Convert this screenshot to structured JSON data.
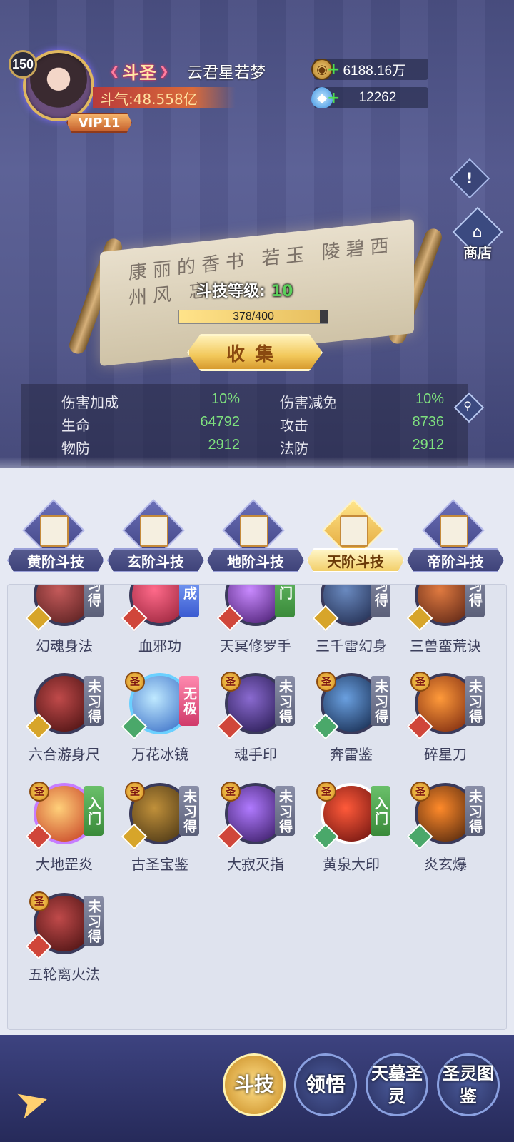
{
  "header": {
    "level": "150",
    "rank_title": "斗圣",
    "player_name": "云君星若梦",
    "power_label": "斗气:48.558亿",
    "vip": "VIP11",
    "gold": "6188.16万",
    "gems": "12262"
  },
  "side": {
    "notice_icon": "!",
    "shop_label": "商店"
  },
  "scroll": {
    "calligraphy": "康丽的香书 若玉 陵碧西 州风 忘",
    "level_label": "斗技等级:",
    "level_value": "10",
    "progress_text": "378/400",
    "progress_fraction": 0.945,
    "collect_label": "收集"
  },
  "stats": {
    "dmg_bonus_label": "伤害加成",
    "dmg_bonus_value": "10%",
    "dmg_reduce_label": "伤害减免",
    "dmg_reduce_value": "10%",
    "hp_label": "生命",
    "hp_value": "64792",
    "atk_label": "攻击",
    "atk_value": "8736",
    "pdef_label": "物防",
    "pdef_value": "2912",
    "mdef_label": "法防",
    "mdef_value": "2912"
  },
  "tabs": [
    {
      "label": "黄阶斗技",
      "active": false
    },
    {
      "label": "玄阶斗技",
      "active": false
    },
    {
      "label": "地阶斗技",
      "active": false
    },
    {
      "label": "天阶斗技",
      "active": true
    },
    {
      "label": "帝阶斗技",
      "active": false
    }
  ],
  "skills": [
    {
      "name": "幻魂身法",
      "status": "习得",
      "badge": "",
      "element": "gold"
    },
    {
      "name": "血邪功",
      "status": "成",
      "badge": "",
      "element": "fire"
    },
    {
      "name": "天冥修罗手",
      "status": "门",
      "badge": "",
      "element": "fire"
    },
    {
      "name": "三千雷幻身",
      "status": "习得",
      "badge": "",
      "element": "gold"
    },
    {
      "name": "三兽蛮荒诀",
      "status": "习得",
      "badge": "",
      "element": "gold"
    },
    {
      "name": "六合游身尺",
      "status": "未习得",
      "badge": "",
      "element": "gold"
    },
    {
      "name": "万花冰镜",
      "status": "无极",
      "badge": "圣",
      "element": "wood"
    },
    {
      "name": "魂手印",
      "status": "未习得",
      "badge": "圣",
      "element": "fire"
    },
    {
      "name": "奔雷鉴",
      "status": "未习得",
      "badge": "圣",
      "element": "wood"
    },
    {
      "name": "碎星刀",
      "status": "未习得",
      "badge": "圣",
      "element": "fire"
    },
    {
      "name": "大地罡炎",
      "status": "入门",
      "badge": "圣",
      "element": "fire"
    },
    {
      "name": "古圣宝鉴",
      "status": "未习得",
      "badge": "圣",
      "element": "gold"
    },
    {
      "name": "大寂灭指",
      "status": "未习得",
      "badge": "圣",
      "element": "fire"
    },
    {
      "name": "黄泉大印",
      "status": "入门",
      "badge": "圣",
      "element": "wood"
    },
    {
      "name": "炎玄爆",
      "status": "未习得",
      "badge": "圣",
      "element": "wood"
    },
    {
      "name": "五轮离火法",
      "status": "未习得",
      "badge": "圣",
      "element": "fire"
    }
  ],
  "nav": [
    {
      "label": "斗技",
      "active": true
    },
    {
      "label": "领悟",
      "active": false
    },
    {
      "label": "天墓圣灵",
      "active": false
    },
    {
      "label": "圣灵图鉴",
      "active": false
    }
  ]
}
